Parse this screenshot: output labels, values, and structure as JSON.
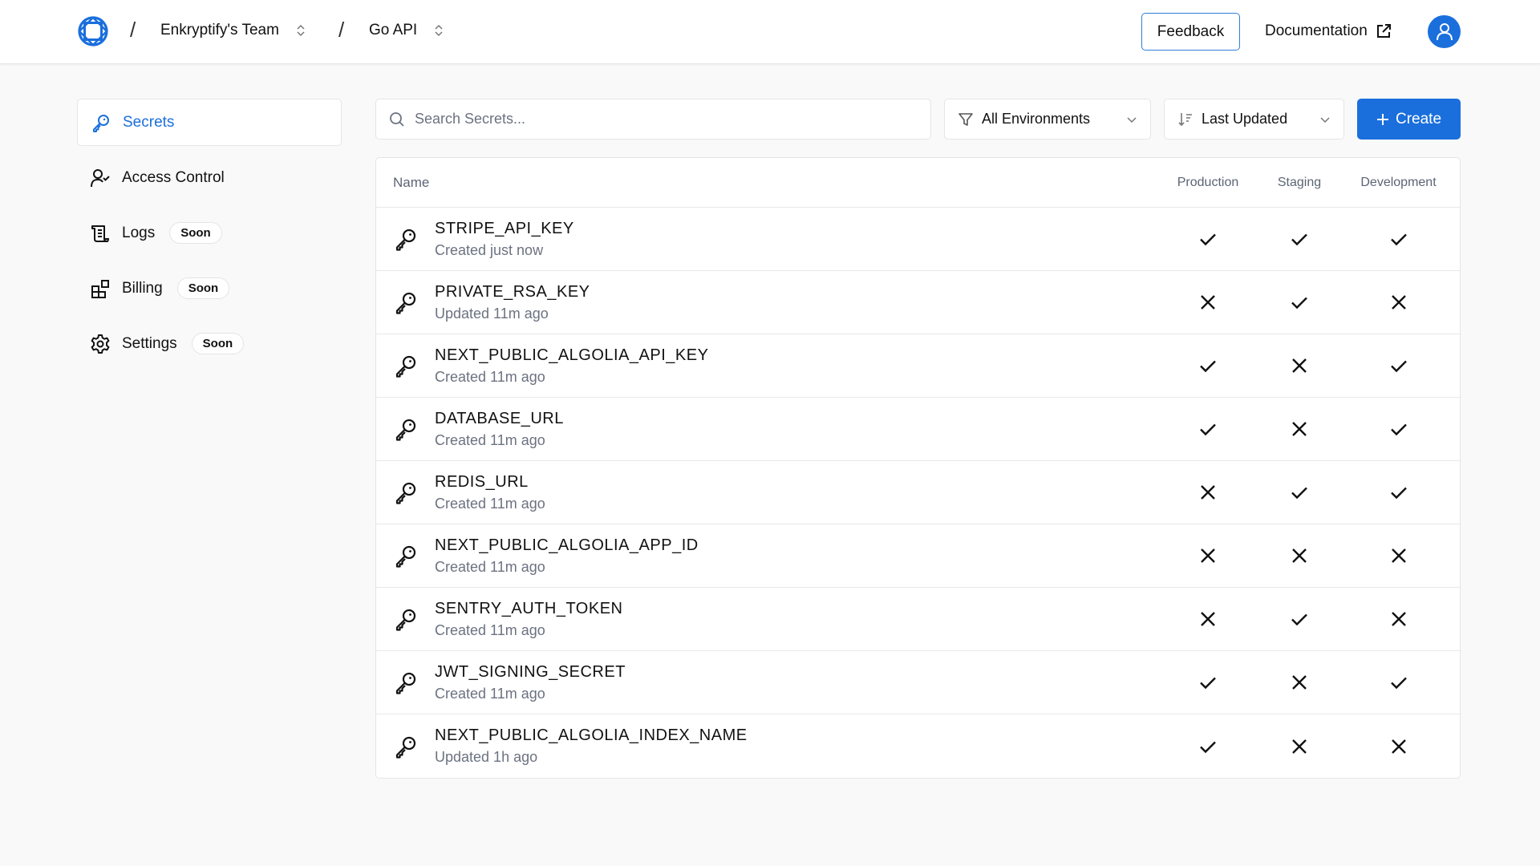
{
  "header": {
    "team": "Enkryptify's Team",
    "project": "Go API",
    "separator": "/",
    "feedback_label": "Feedback",
    "documentation_label": "Documentation",
    "brand_color": "#1a6fdc"
  },
  "sidebar": {
    "items": [
      {
        "label": "Secrets",
        "icon": "key-icon",
        "active": true
      },
      {
        "label": "Access Control",
        "icon": "user-check-icon"
      },
      {
        "label": "Logs",
        "icon": "scroll-icon",
        "badge": "Soon"
      },
      {
        "label": "Billing",
        "icon": "blocks-icon",
        "badge": "Soon"
      },
      {
        "label": "Settings",
        "icon": "gear-icon",
        "badge": "Soon"
      }
    ]
  },
  "toolbar": {
    "search_placeholder": "Search Secrets...",
    "search_value": "",
    "environment_filter": "All Environments",
    "sort": "Last Updated",
    "create_label": "Create"
  },
  "table": {
    "columns": [
      "Name",
      "Production",
      "Staging",
      "Development"
    ],
    "rows": [
      {
        "name": "STRIPE_API_KEY",
        "status": "Created just now",
        "production": true,
        "staging": true,
        "development": true
      },
      {
        "name": "PRIVATE_RSA_KEY",
        "status": "Updated 11m ago",
        "production": false,
        "staging": true,
        "development": false
      },
      {
        "name": "NEXT_PUBLIC_ALGOLIA_API_KEY",
        "status": "Created 11m ago",
        "production": true,
        "staging": false,
        "development": true
      },
      {
        "name": "DATABASE_URL",
        "status": "Created 11m ago",
        "production": true,
        "staging": false,
        "development": true
      },
      {
        "name": "REDIS_URL",
        "status": "Created 11m ago",
        "production": false,
        "staging": true,
        "development": true
      },
      {
        "name": "NEXT_PUBLIC_ALGOLIA_APP_ID",
        "status": "Created 11m ago",
        "production": false,
        "staging": false,
        "development": false
      },
      {
        "name": "SENTRY_AUTH_TOKEN",
        "status": "Created 11m ago",
        "production": false,
        "staging": true,
        "development": false
      },
      {
        "name": "JWT_SIGNING_SECRET",
        "status": "Created 11m ago",
        "production": true,
        "staging": false,
        "development": true
      },
      {
        "name": "NEXT_PUBLIC_ALGOLIA_INDEX_NAME",
        "status": "Updated 1h ago",
        "production": true,
        "staging": false,
        "development": false
      }
    ]
  }
}
